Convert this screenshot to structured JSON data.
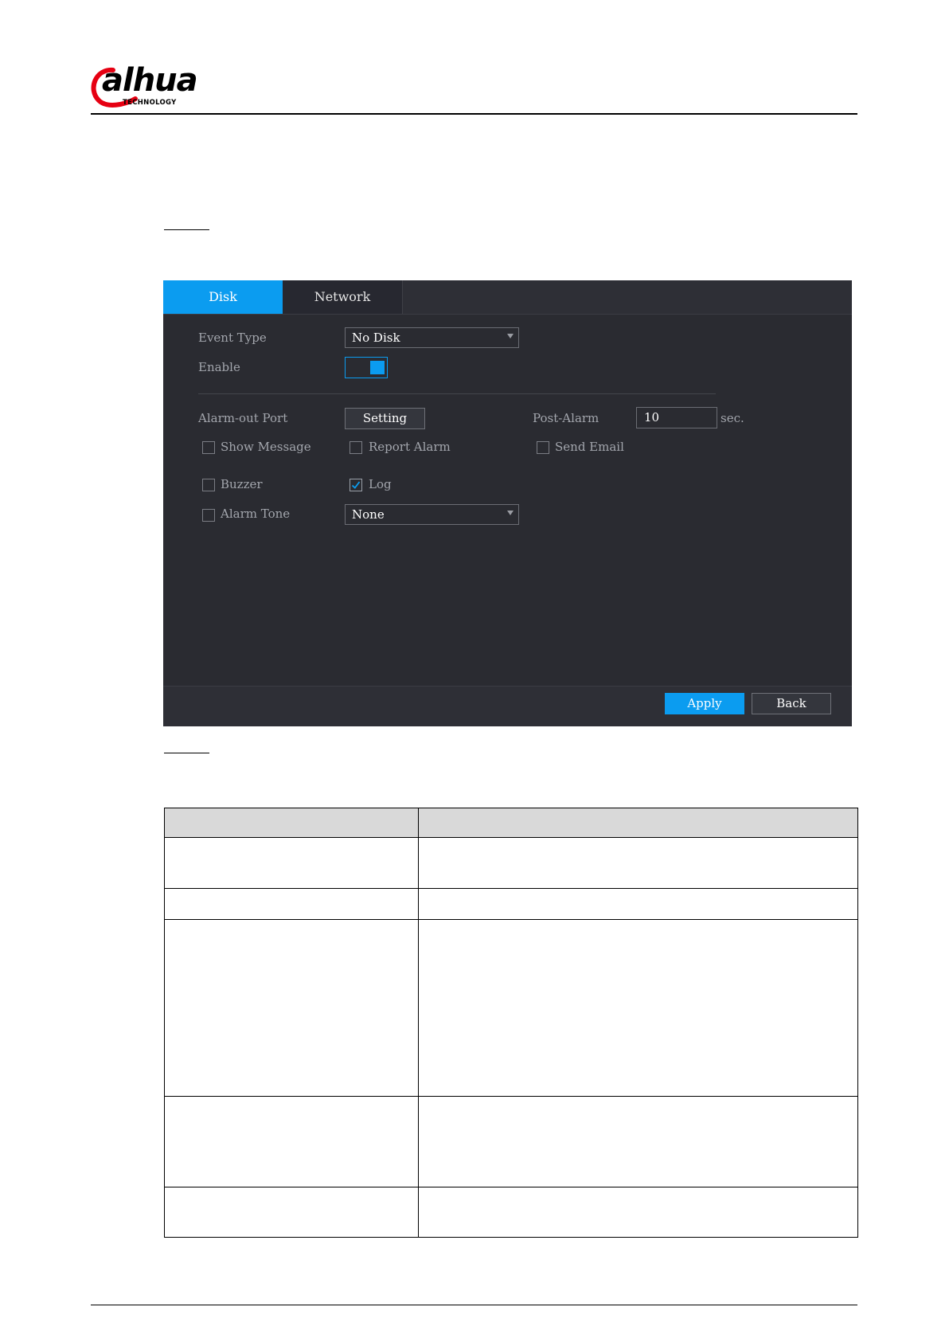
{
  "logo": {
    "word": "alhua",
    "sub": "TECHNOLOGY"
  },
  "tabs": [
    {
      "label": "Disk",
      "active": true
    },
    {
      "label": "Network",
      "active": false
    }
  ],
  "form": {
    "event_type": {
      "label": "Event Type",
      "value": "No Disk"
    },
    "enable": {
      "label": "Enable",
      "on": true
    },
    "alarm_out": {
      "label": "Alarm-out Port",
      "button": "Setting"
    },
    "post_alarm": {
      "label": "Post-Alarm",
      "value": "10",
      "unit": "sec."
    },
    "show_message": {
      "label": "Show Message",
      "checked": false
    },
    "report_alarm": {
      "label": "Report Alarm",
      "checked": false
    },
    "send_email": {
      "label": "Send Email",
      "checked": false
    },
    "buzzer": {
      "label": "Buzzer",
      "checked": false
    },
    "log": {
      "label": "Log",
      "checked": true
    },
    "alarm_tone": {
      "label": "Alarm Tone",
      "checked": false,
      "value": "None"
    }
  },
  "footer": {
    "apply": "Apply",
    "back": "Back"
  },
  "colors": {
    "accent": "#0b9cf0",
    "panel_bg": "#2a2b31",
    "table_header": "#d9d9d9",
    "logo_red": "#e60012"
  }
}
